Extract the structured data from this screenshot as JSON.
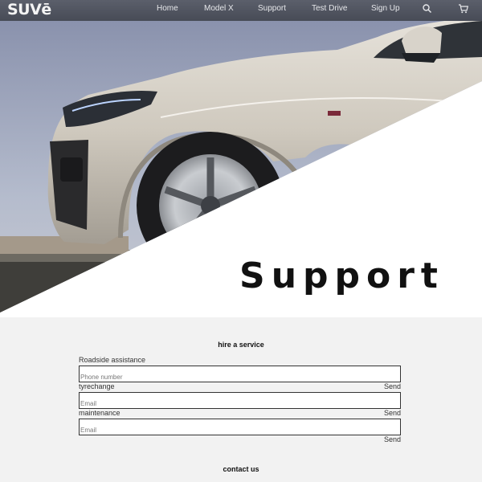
{
  "nav": {
    "logo": "SUVē",
    "links": [
      "Home",
      "Model X",
      "Support",
      "Test Drive",
      "Sign Up"
    ],
    "icons": [
      "search-icon",
      "cart-icon"
    ]
  },
  "hero": {
    "title": "Support"
  },
  "hire": {
    "title": "hire a service",
    "services": [
      {
        "label": "Roadside assistance",
        "placeholder": "Phone number",
        "send": ""
      },
      {
        "label": "tyrechange",
        "placeholder": "Email",
        "send": "Send"
      },
      {
        "label": "maintenance",
        "placeholder": "Email",
        "send": "Send"
      },
      {
        "label": "",
        "placeholder": "",
        "send": "Send"
      }
    ]
  },
  "contact": {
    "title": "contact us"
  },
  "colors": {
    "nav": "#4f535e",
    "background": "#f2f2f2",
    "text": "#111111"
  }
}
